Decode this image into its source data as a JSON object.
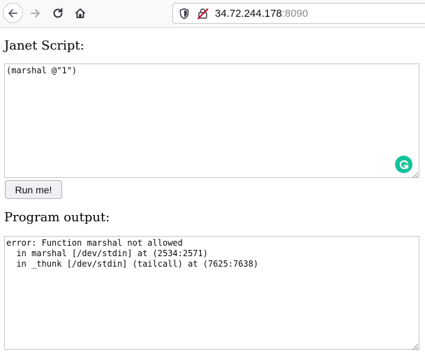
{
  "browser": {
    "url_host": "34.72.244.178",
    "url_port": ":8090",
    "icons": [
      "back-arrow-icon",
      "forward-arrow-icon",
      "reload-icon",
      "home-icon",
      "shield-icon",
      "insecure-lock-icon"
    ]
  },
  "page": {
    "script_heading": "Janet Script:",
    "script_value": "(marshal @\"1\")",
    "run_button_label": "Run me!",
    "output_heading": "Program output:",
    "output_lines": [
      "error: Function marshal not allowed",
      "  in marshal [/dev/stdin] at (2534:2571)",
      "  in _thunk [/dev/stdin] (tailcall) at (7625:7638)"
    ],
    "grammarly_glyph": "G"
  },
  "colors": {
    "grammarly": "#15c39a",
    "insecure_slash": "#d70022"
  }
}
